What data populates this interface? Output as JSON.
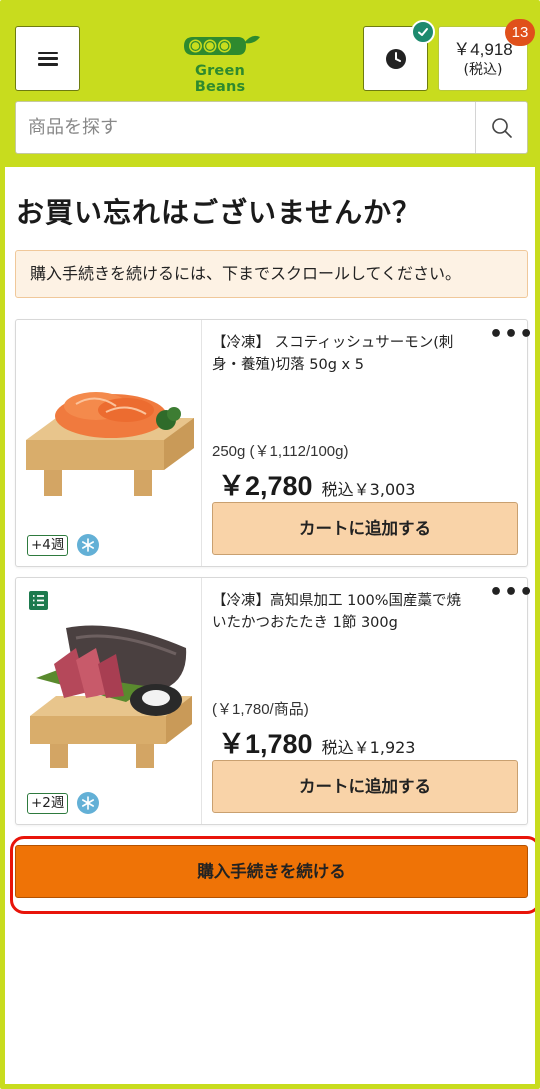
{
  "header": {
    "menu_icon": "hamburger-menu-icon",
    "logo_text": "Green Beans",
    "history_icon": "clock-icon",
    "check_icon": "check-icon",
    "cart_amount": "￥4,918",
    "cart_tax_label": "(税込)",
    "cart_count": "13"
  },
  "search": {
    "placeholder": "商品を探す",
    "icon": "search-icon"
  },
  "page": {
    "title": "お買い忘れはございませんか？",
    "notice": "購入手続きを続けるには、下までスクロールしてください。"
  },
  "products": [
    {
      "name": "【冷凍】 スコティッシュサーモン(刺身・養殖)切落 50g x 5",
      "unit_price": "250g (￥1,112/100g)",
      "price": "￥2,780",
      "price_tax_included": "税込￥3,003",
      "add_button": "カートに追加する",
      "delivery_weeks": "+4週",
      "frozen_icon": "snowflake-icon",
      "more_icon": "more-options-icon",
      "image": "salmon-sashimi-image"
    },
    {
      "name": "【冷凍】高知県加工 100%国産藁で焼いたかつおたたき 1節 300g",
      "unit_price": "(￥1,780/商品)",
      "price": "￥1,780",
      "price_tax_included": "税込￥1,923",
      "add_button": "カートに追加する",
      "delivery_weeks": "+2週",
      "frozen_icon": "snowflake-icon",
      "more_icon": "more-options-icon",
      "list_icon": "list-icon",
      "image": "bonito-tataki-image"
    }
  ],
  "checkout": {
    "label": "購入手続きを続ける"
  },
  "colors": {
    "brand_green": "#c8dc1e",
    "checkout_orange": "#ef7306",
    "add_button": "#f9d3a8",
    "badge": "#e0501b",
    "highlight": "#e8140a"
  }
}
